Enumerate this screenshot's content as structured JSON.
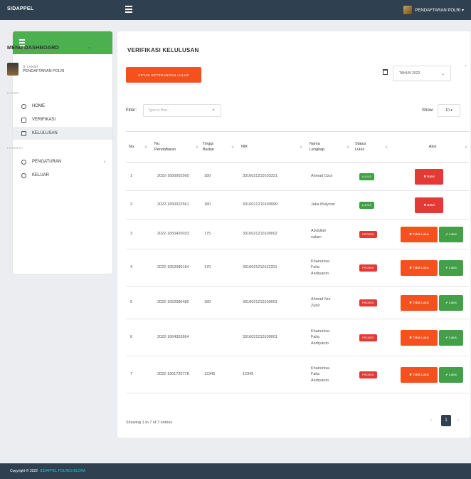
{
  "topbar": {
    "brand": "SIDAPPEL",
    "user_label": "PENDAFTARAN POLRI ▾"
  },
  "sidebar": {
    "menu_title": "MENU DASHBOARD",
    "profile_line1": "S. Lestari",
    "profile_line2": "PENDAFTARAN POLRI",
    "section1": "UTAMA",
    "items_main": [
      {
        "label": "HOME"
      },
      {
        "label": "VERIFIKASI"
      },
      {
        "label": "KELULUSAN"
      }
    ],
    "section2": "LAINNYA",
    "items_other": [
      {
        "label": "PENGATURAN"
      },
      {
        "label": "KELUAR"
      }
    ]
  },
  "page": {
    "title": "VERIFIKASI KELULUSAN",
    "cetak_button": "CETAK KETERANGAN LULUS",
    "tahun_value": "TAHUN 2022",
    "filter_label": "Filter:",
    "filter_placeholder": "Type to filter...",
    "show_label": "Show:",
    "show_value": "10 ▾"
  },
  "table": {
    "headers": [
      "No.",
      "No. Pendaftaran",
      "Tinggi Badan",
      "NIK",
      "Nama Lengkap",
      "Status Lulus",
      "Aksi"
    ],
    "rows": [
      {
        "no": "1",
        "reg": "2022-1650002560",
        "tinggi": "180",
        "nik": "3316021210103321",
        "nama": "Ahmad Dzul",
        "status": "LULUS",
        "status_kind": "green",
        "actions": "batal"
      },
      {
        "no": "2",
        "reg": "2022-1650022561",
        "tinggi": "180",
        "nik": "3316021210109999",
        "nama": "Jaka Mulyono",
        "status": "LULUS",
        "status_kind": "green",
        "actions": "batal"
      },
      {
        "no": "3",
        "reg": "2022-1650420033",
        "tinggi": "175",
        "nik": "3316021210100002",
        "nama": "Abdullah salam",
        "status": "PROSES",
        "status_kind": "orange",
        "actions": "choose"
      },
      {
        "no": "4",
        "reg": "2022-1652080154",
        "tinggi": "170",
        "nik": "3316021210112201",
        "nama": "Khairunisa Falia Andryanto",
        "status": "PROSES",
        "status_kind": "orange",
        "actions": "choose"
      },
      {
        "no": "5",
        "reg": "2022-1652086480",
        "tinggi": "180",
        "nik": "3316021210100001",
        "nama": "Ahmad Nur Zubir",
        "status": "PROSES",
        "status_kind": "orange",
        "actions": "choose"
      },
      {
        "no": "6",
        "reg": "2022-1664353664",
        "tinggi": "",
        "nik": "3316021210100001",
        "nama": "Khairunisa Falia Andryanto",
        "status": "PROSES",
        "status_kind": "orange",
        "actions": "choose"
      },
      {
        "no": "7",
        "reg": "2022-1661720778",
        "tinggi": "12345",
        "nik": "12345",
        "nama": "Khairunisa Falia Andryanto",
        "status": "PROSES",
        "status_kind": "orange",
        "actions": "choose"
      }
    ],
    "batal_label": "✖ Batal",
    "tidak_lulus_label": "✖ Tidak Lulus",
    "lulus_label": "✔ Lulus"
  },
  "pagination": {
    "info": "Showing 1 to 7 of 7 entries",
    "current": "1",
    "prev": "‹",
    "next": "›"
  },
  "footer": {
    "copyright": "Copyright © 2022",
    "link": "SIDAPPEL POLRES BLORA"
  },
  "colors": {
    "topbar": "#2f4050",
    "sidebar_header": "#4caf50",
    "accent_orange": "#f4511e",
    "danger": "#e53935",
    "success": "#43a047"
  }
}
